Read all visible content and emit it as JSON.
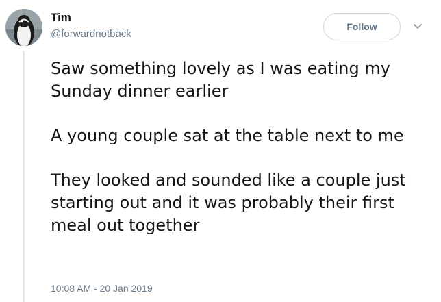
{
  "author": {
    "name": "Tim",
    "handle": "@forwardnotback"
  },
  "actions": {
    "follow_label": "Follow",
    "more_icon": "chevron-down-icon"
  },
  "tweet": {
    "paragraphs": [
      "Saw something lovely as I was eating my Sunday dinner earlier",
      "A young couple sat at the table next to me",
      "They looked and sounded like a couple just starting out and it was probably their first meal out together"
    ],
    "timestamp": "10:08 AM - 20 Jan 2019"
  },
  "colors": {
    "text": "#14171a",
    "secondary": "#657786",
    "border": "#ccd6dd",
    "thread": "#e1e8ed"
  }
}
